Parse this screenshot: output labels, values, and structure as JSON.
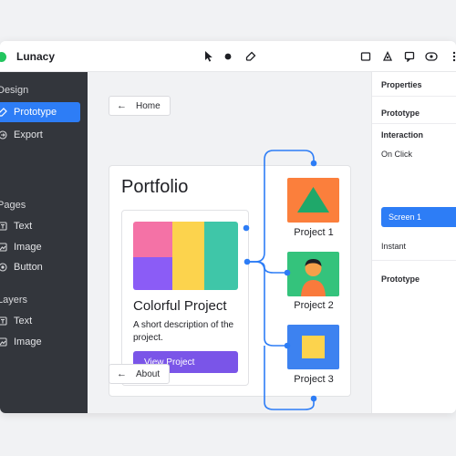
{
  "app": {
    "title": "Lunacy"
  },
  "toolbar": {
    "tools": [
      "pointer-icon",
      "circle-tool-icon",
      "eraser-icon"
    ],
    "right_tools": [
      "frame-icon",
      "shape-icon",
      "comment-icon",
      "preview-icon",
      "more-icon"
    ]
  },
  "sidebar": {
    "design_title": "Design",
    "design_items": [
      {
        "label": "Prototype",
        "icon": "prototype-icon",
        "active": true
      },
      {
        "label": "Export",
        "icon": "export-icon",
        "active": false
      }
    ],
    "pages_title": "Pages",
    "pages_items": [
      {
        "label": "Text",
        "icon": "text-icon"
      },
      {
        "label": "Image",
        "icon": "image-icon"
      },
      {
        "label": "Button",
        "icon": "button-icon"
      }
    ],
    "layers_title": "Layers",
    "layers_items": [
      {
        "label": "Text",
        "icon": "text-icon"
      },
      {
        "label": "Image",
        "icon": "image-icon"
      }
    ]
  },
  "canvas": {
    "home_label": "Home",
    "about_label": "About",
    "frame_title": "Portfolio",
    "card": {
      "title": "Colorful Project",
      "description": "A short description of the project.",
      "button": "View Project"
    },
    "projects": [
      {
        "label": "Project 1"
      },
      {
        "label": "Project 2"
      },
      {
        "label": "Project 3"
      }
    ]
  },
  "colors": {
    "accent": "#2d7df6",
    "button_purple": "#7a55e8",
    "sidebar_bg": "#33363c",
    "connector": "#2d7df6",
    "swatch_pink": "#f472a6",
    "swatch_yellow": "#fcd34d",
    "swatch_teal": "#3fc6a8",
    "swatch_violet": "#8b5cf6",
    "thumb_orange": "#fb7f3c",
    "thumb_green": "#34c37c",
    "thumb_blue": "#3d82f0"
  },
  "panel": {
    "properties": "Properties",
    "prototype": "Prototype",
    "interaction": "Interaction",
    "on_click": "On Click",
    "screen": "Screen 1",
    "instant": "Instant",
    "prototype2": "Prototype"
  }
}
